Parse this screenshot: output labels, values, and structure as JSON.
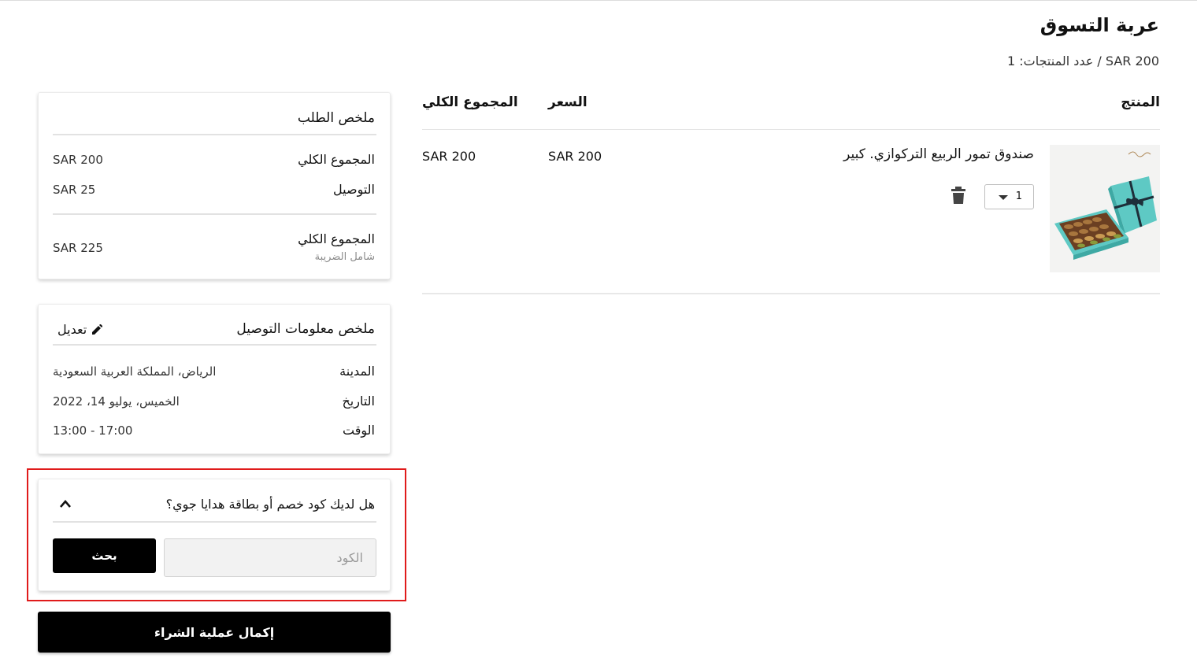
{
  "colors": {
    "accent": "#000000",
    "highlight_border": "#e01b1b",
    "product_box": "#5ec9c4"
  },
  "header": {
    "title": "عربة التسوق",
    "summary": "SAR 200 / عدد المنتجات: 1"
  },
  "cart_table": {
    "columns": {
      "product": "المنتج",
      "price": "السعر",
      "total": "المجموع الكلي"
    },
    "items": [
      {
        "name": "صندوق تمور الربيع التركوازي. كبير",
        "quantity": "1",
        "price": "SAR 200",
        "total": "SAR 200",
        "image_icon": "date-box-product-image"
      }
    ]
  },
  "order_summary": {
    "title": "ملخص الطلب",
    "subtotal_label": "المجموع الكلي",
    "subtotal_value": "SAR 200",
    "delivery_label": "التوصيل",
    "delivery_value": "SAR 25",
    "grand_total_label": "المجموع الكلي",
    "grand_total_value": "SAR 225",
    "tax_note": "شامل الضريبة"
  },
  "delivery_summary": {
    "title": "ملخص معلومات التوصيل",
    "edit_label": "تعديل",
    "city_label": "المدينة",
    "city_value": "الرياض، المملكة العربية السعودية",
    "date_label": "التاريخ",
    "date_value": "الخميس، يوليو 14، 2022",
    "time_label": "الوقت",
    "time_value": "13:00 - 17:00"
  },
  "coupon": {
    "question": "هل لديك كود خصم أو بطاقة هدايا جوي؟",
    "input_placeholder": "الكود",
    "input_value": "",
    "search_label": "بحث"
  },
  "checkout": {
    "label": "إكمال عملية الشراء"
  }
}
